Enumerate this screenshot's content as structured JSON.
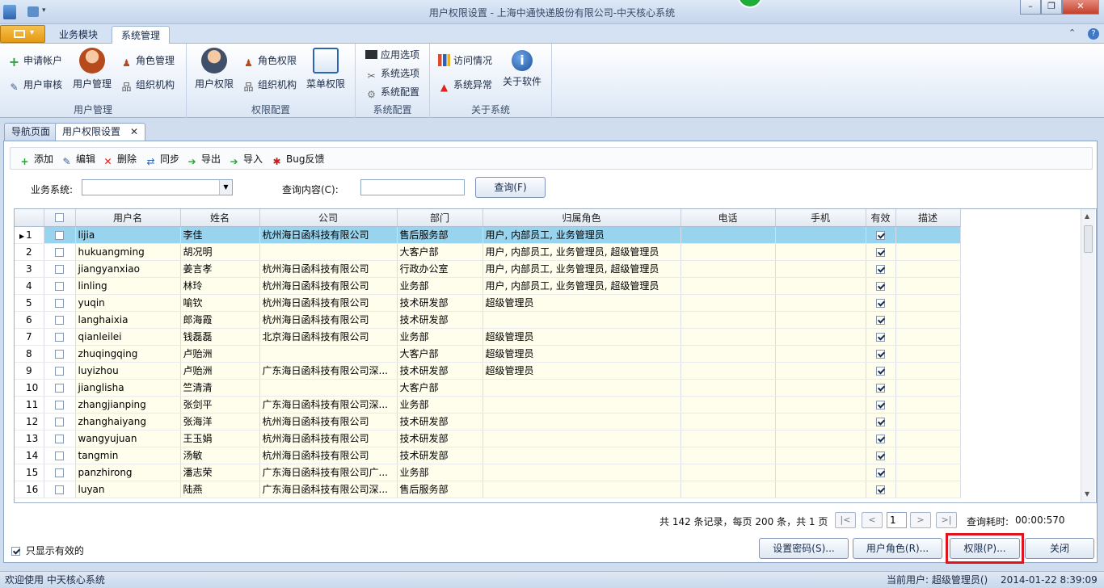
{
  "window": {
    "title": "用户权限设置 - 上海中通快递股份有限公司-中天核心系统"
  },
  "ribbon": {
    "tabs": [
      "业务模块",
      "系统管理"
    ],
    "groups": {
      "user_mgmt": {
        "label": "用户管理",
        "apply_account": "申请帐户",
        "user_audit": "用户审核",
        "user_manage": "用户管理",
        "role_manage": "角色管理",
        "org": "组织机构"
      },
      "perm_cfg": {
        "label": "权限配置",
        "user_perm": "用户权限",
        "role_perm": "角色权限",
        "org": "组织机构",
        "menu_perm": "菜单权限"
      },
      "sys_cfg": {
        "label": "系统配置",
        "app_options": "应用选项",
        "sys_options": "系统选项",
        "sys_config": "系统配置"
      },
      "about": {
        "label": "关于系统",
        "visits": "访问情况",
        "sys_errors": "系统异常",
        "about_sw": "关于软件"
      }
    }
  },
  "doc_tabs": [
    "导航页面",
    "用户权限设置"
  ],
  "toolbar": {
    "add": "添加",
    "edit": "编辑",
    "delete": "删除",
    "sync": "同步",
    "export": "导出",
    "import": "导入",
    "bug": "Bug反馈"
  },
  "filter": {
    "system_label": "业务系统:",
    "system_value": "",
    "query_label": "查询内容(C):",
    "query_value": "",
    "query_button": "查询(F)"
  },
  "grid": {
    "columns": [
      "用户名",
      "姓名",
      "公司",
      "部门",
      "归属角色",
      "电话",
      "手机",
      "有效",
      "描述"
    ],
    "rows": [
      {
        "n": "1",
        "user": "lijia",
        "name": "李佳",
        "company": "杭州海日函科技有限公司",
        "dept": "售后服务部",
        "role": "用户, 内部员工, 业务管理员",
        "tel": "",
        "mobile": "",
        "valid": true,
        "desc": ""
      },
      {
        "n": "2",
        "user": "hukuangming",
        "name": "胡况明",
        "company": "",
        "dept": "大客户部",
        "role": "用户, 内部员工, 业务管理员, 超级管理员",
        "tel": "",
        "mobile": "",
        "valid": true,
        "desc": ""
      },
      {
        "n": "3",
        "user": "jiangyanxiao",
        "name": "姜言孝",
        "company": "杭州海日函科技有限公司",
        "dept": "行政办公室",
        "role": "用户, 内部员工, 业务管理员, 超级管理员",
        "tel": "",
        "mobile": "",
        "valid": true,
        "desc": ""
      },
      {
        "n": "4",
        "user": "linling",
        "name": "林玲",
        "company": "杭州海日函科技有限公司",
        "dept": "业务部",
        "role": "用户, 内部员工, 业务管理员, 超级管理员",
        "tel": "",
        "mobile": "",
        "valid": true,
        "desc": ""
      },
      {
        "n": "5",
        "user": "yuqin",
        "name": "喻钦",
        "company": "杭州海日函科技有限公司",
        "dept": "技术研发部",
        "role": "超级管理员",
        "tel": "",
        "mobile": "",
        "valid": true,
        "desc": ""
      },
      {
        "n": "6",
        "user": "langhaixia",
        "name": "郎海霞",
        "company": "杭州海日函科技有限公司",
        "dept": "技术研发部",
        "role": "",
        "tel": "",
        "mobile": "",
        "valid": true,
        "desc": ""
      },
      {
        "n": "7",
        "user": "qianleilei",
        "name": "钱磊磊",
        "company": "北京海日函科技有限公司",
        "dept": "业务部",
        "role": "超级管理员",
        "tel": "",
        "mobile": "",
        "valid": true,
        "desc": ""
      },
      {
        "n": "8",
        "user": "zhuqingqing",
        "name": "卢贻洲",
        "company": "",
        "dept": "大客户部",
        "role": "超级管理员",
        "tel": "",
        "mobile": "",
        "valid": true,
        "desc": ""
      },
      {
        "n": "9",
        "user": "luyizhou",
        "name": "卢贻洲",
        "company": "广东海日函科技有限公司深...",
        "dept": "技术研发部",
        "role": "超级管理员",
        "tel": "",
        "mobile": "",
        "valid": true,
        "desc": ""
      },
      {
        "n": "10",
        "user": "jianglisha",
        "name": "竺清清",
        "company": "",
        "dept": "大客户部",
        "role": "",
        "tel": "",
        "mobile": "",
        "valid": true,
        "desc": ""
      },
      {
        "n": "11",
        "user": "zhangjianping",
        "name": "张剑平",
        "company": "广东海日函科技有限公司深...",
        "dept": "业务部",
        "role": "",
        "tel": "",
        "mobile": "",
        "valid": true,
        "desc": ""
      },
      {
        "n": "12",
        "user": "zhanghaiyang",
        "name": "张海洋",
        "company": "杭州海日函科技有限公司",
        "dept": "技术研发部",
        "role": "",
        "tel": "",
        "mobile": "",
        "valid": true,
        "desc": ""
      },
      {
        "n": "13",
        "user": "wangyujuan",
        "name": "王玉娟",
        "company": "杭州海日函科技有限公司",
        "dept": "技术研发部",
        "role": "",
        "tel": "",
        "mobile": "",
        "valid": true,
        "desc": ""
      },
      {
        "n": "14",
        "user": "tangmin",
        "name": "汤敏",
        "company": "杭州海日函科技有限公司",
        "dept": "技术研发部",
        "role": "",
        "tel": "",
        "mobile": "",
        "valid": true,
        "desc": ""
      },
      {
        "n": "15",
        "user": "panzhirong",
        "name": "潘志荣",
        "company": "广东海日函科技有限公司广...",
        "dept": "业务部",
        "role": "",
        "tel": "",
        "mobile": "",
        "valid": true,
        "desc": ""
      },
      {
        "n": "16",
        "user": "luyan",
        "name": "陆燕",
        "company": "广东海日函科技有限公司深...",
        "dept": "售后服务部",
        "role": "",
        "tel": "",
        "mobile": "",
        "valid": true,
        "desc": ""
      }
    ]
  },
  "pager": {
    "summary": "共 142 条记录，每页 200 条，共 1 页",
    "page": "1",
    "first": "|<",
    "prev": "<",
    "next": ">",
    "last": ">|",
    "elapsed_label": "查询耗时:",
    "elapsed": "00:00:570"
  },
  "footer": {
    "show_valid": "只显示有效的",
    "set_password": "设置密码(S)...",
    "user_role": "用户角色(R)...",
    "permission": "权限(P)...",
    "close": "关闭"
  },
  "status": {
    "welcome": "欢迎使用 中天核心系统",
    "current_user": "当前用户: 超级管理员()",
    "datetime": "2014-01-22 8:39:09"
  },
  "colors": {
    "selected_row": "#99d4ef",
    "row_bg": "#fffdeb",
    "highlight_border": "#e0141e",
    "status_ok": "#1fae3a"
  }
}
